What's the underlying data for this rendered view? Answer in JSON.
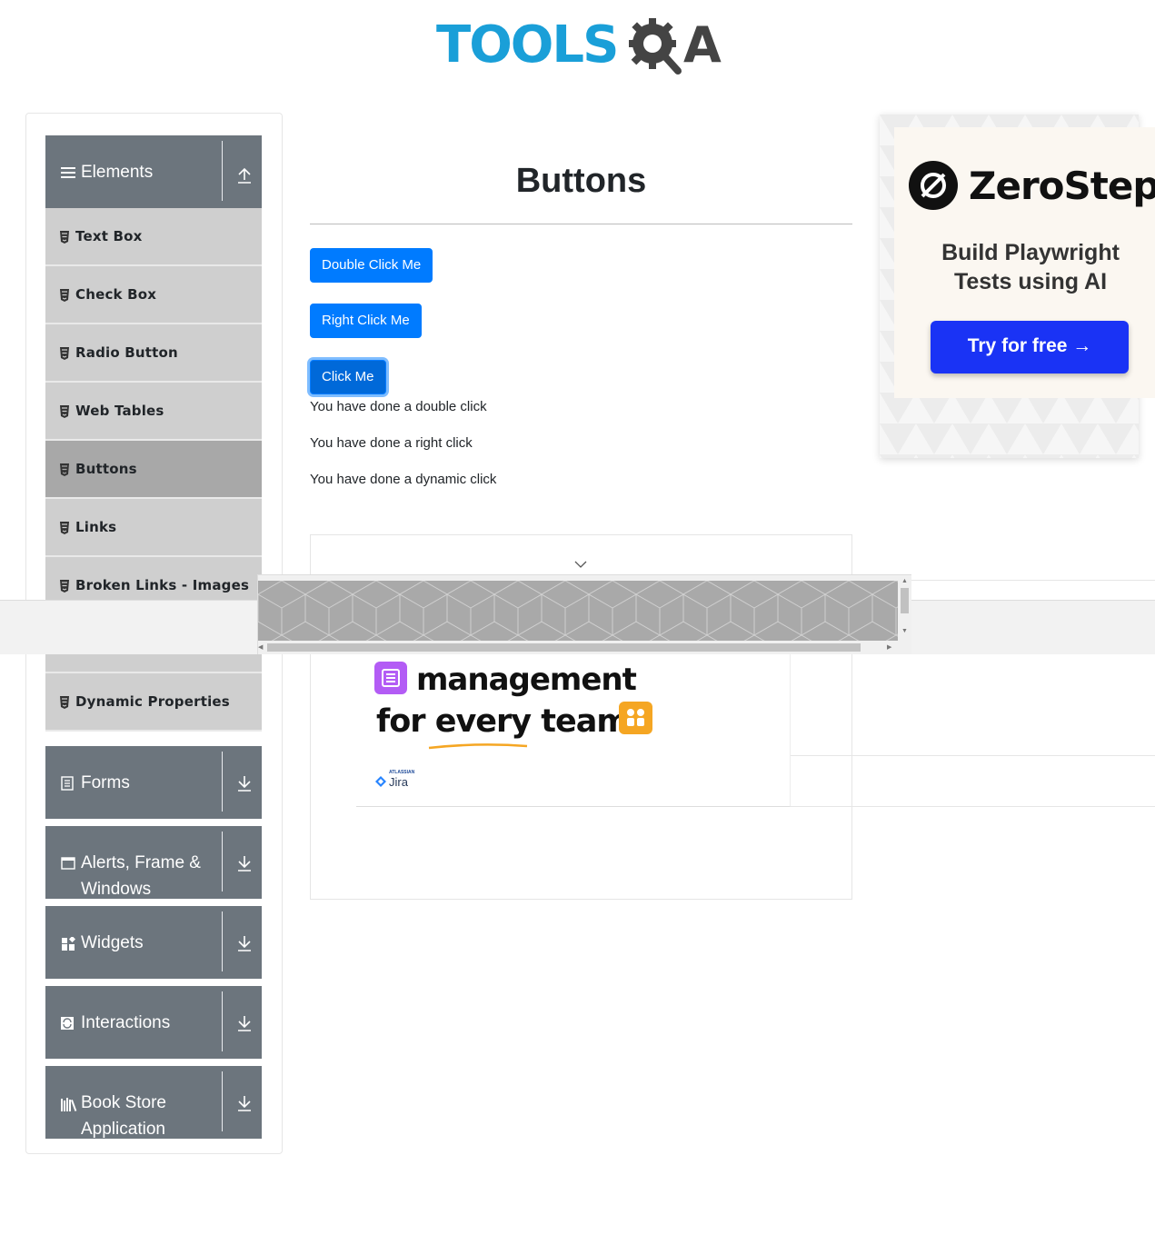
{
  "header": {
    "logo_tools": "TOOLS",
    "logo_a": "A"
  },
  "sidebar": {
    "groups": [
      {
        "title": "Elements",
        "icon": "hamburger-icon",
        "expanded": true
      },
      {
        "title": "Forms",
        "icon": "document-icon",
        "expanded": false
      },
      {
        "title": "Alerts, Frame &",
        "title2": "Windows",
        "icon": "window-icon",
        "expanded": false
      },
      {
        "title": "Widgets",
        "icon": "widgets-icon",
        "expanded": false
      },
      {
        "title": "Interactions",
        "icon": "interactions-icon",
        "expanded": false
      },
      {
        "title": "Book Store",
        "title2": "Application",
        "icon": "books-icon",
        "expanded": false
      }
    ],
    "elements_items": [
      {
        "label": "Text Box"
      },
      {
        "label": "Check Box"
      },
      {
        "label": "Radio Button"
      },
      {
        "label": "Web Tables"
      },
      {
        "label": "Buttons",
        "active": true
      },
      {
        "label": "Links"
      },
      {
        "label": "Broken Links - Images"
      },
      {
        "label": "Dynamic Properties"
      }
    ]
  },
  "main": {
    "title": "Buttons",
    "buttons": {
      "double_click": "Double Click Me",
      "right_click": "Right Click Me",
      "click": "Click Me"
    },
    "messages": {
      "double": "You have done a double click",
      "right": "You have done a right click",
      "dynamic": "You have done a dynamic click"
    }
  },
  "jira_ad": {
    "line1": "management",
    "line2": "for every team",
    "atlassian": "ATLASSIAN",
    "brand": "Jira"
  },
  "zerostep_ad": {
    "brand": "ZeroStep",
    "tagline1": "Build Playwright",
    "tagline2": "Tests using AI",
    "cta": "Try for free →"
  },
  "colors": {
    "primary": "#007bff",
    "sidebar_header": "#6c757d",
    "menu_item": "#cfcfcf",
    "menu_active": "#a8a8a8",
    "logo_blue": "#1a9fd8",
    "zs_cta": "#1a33f5"
  }
}
